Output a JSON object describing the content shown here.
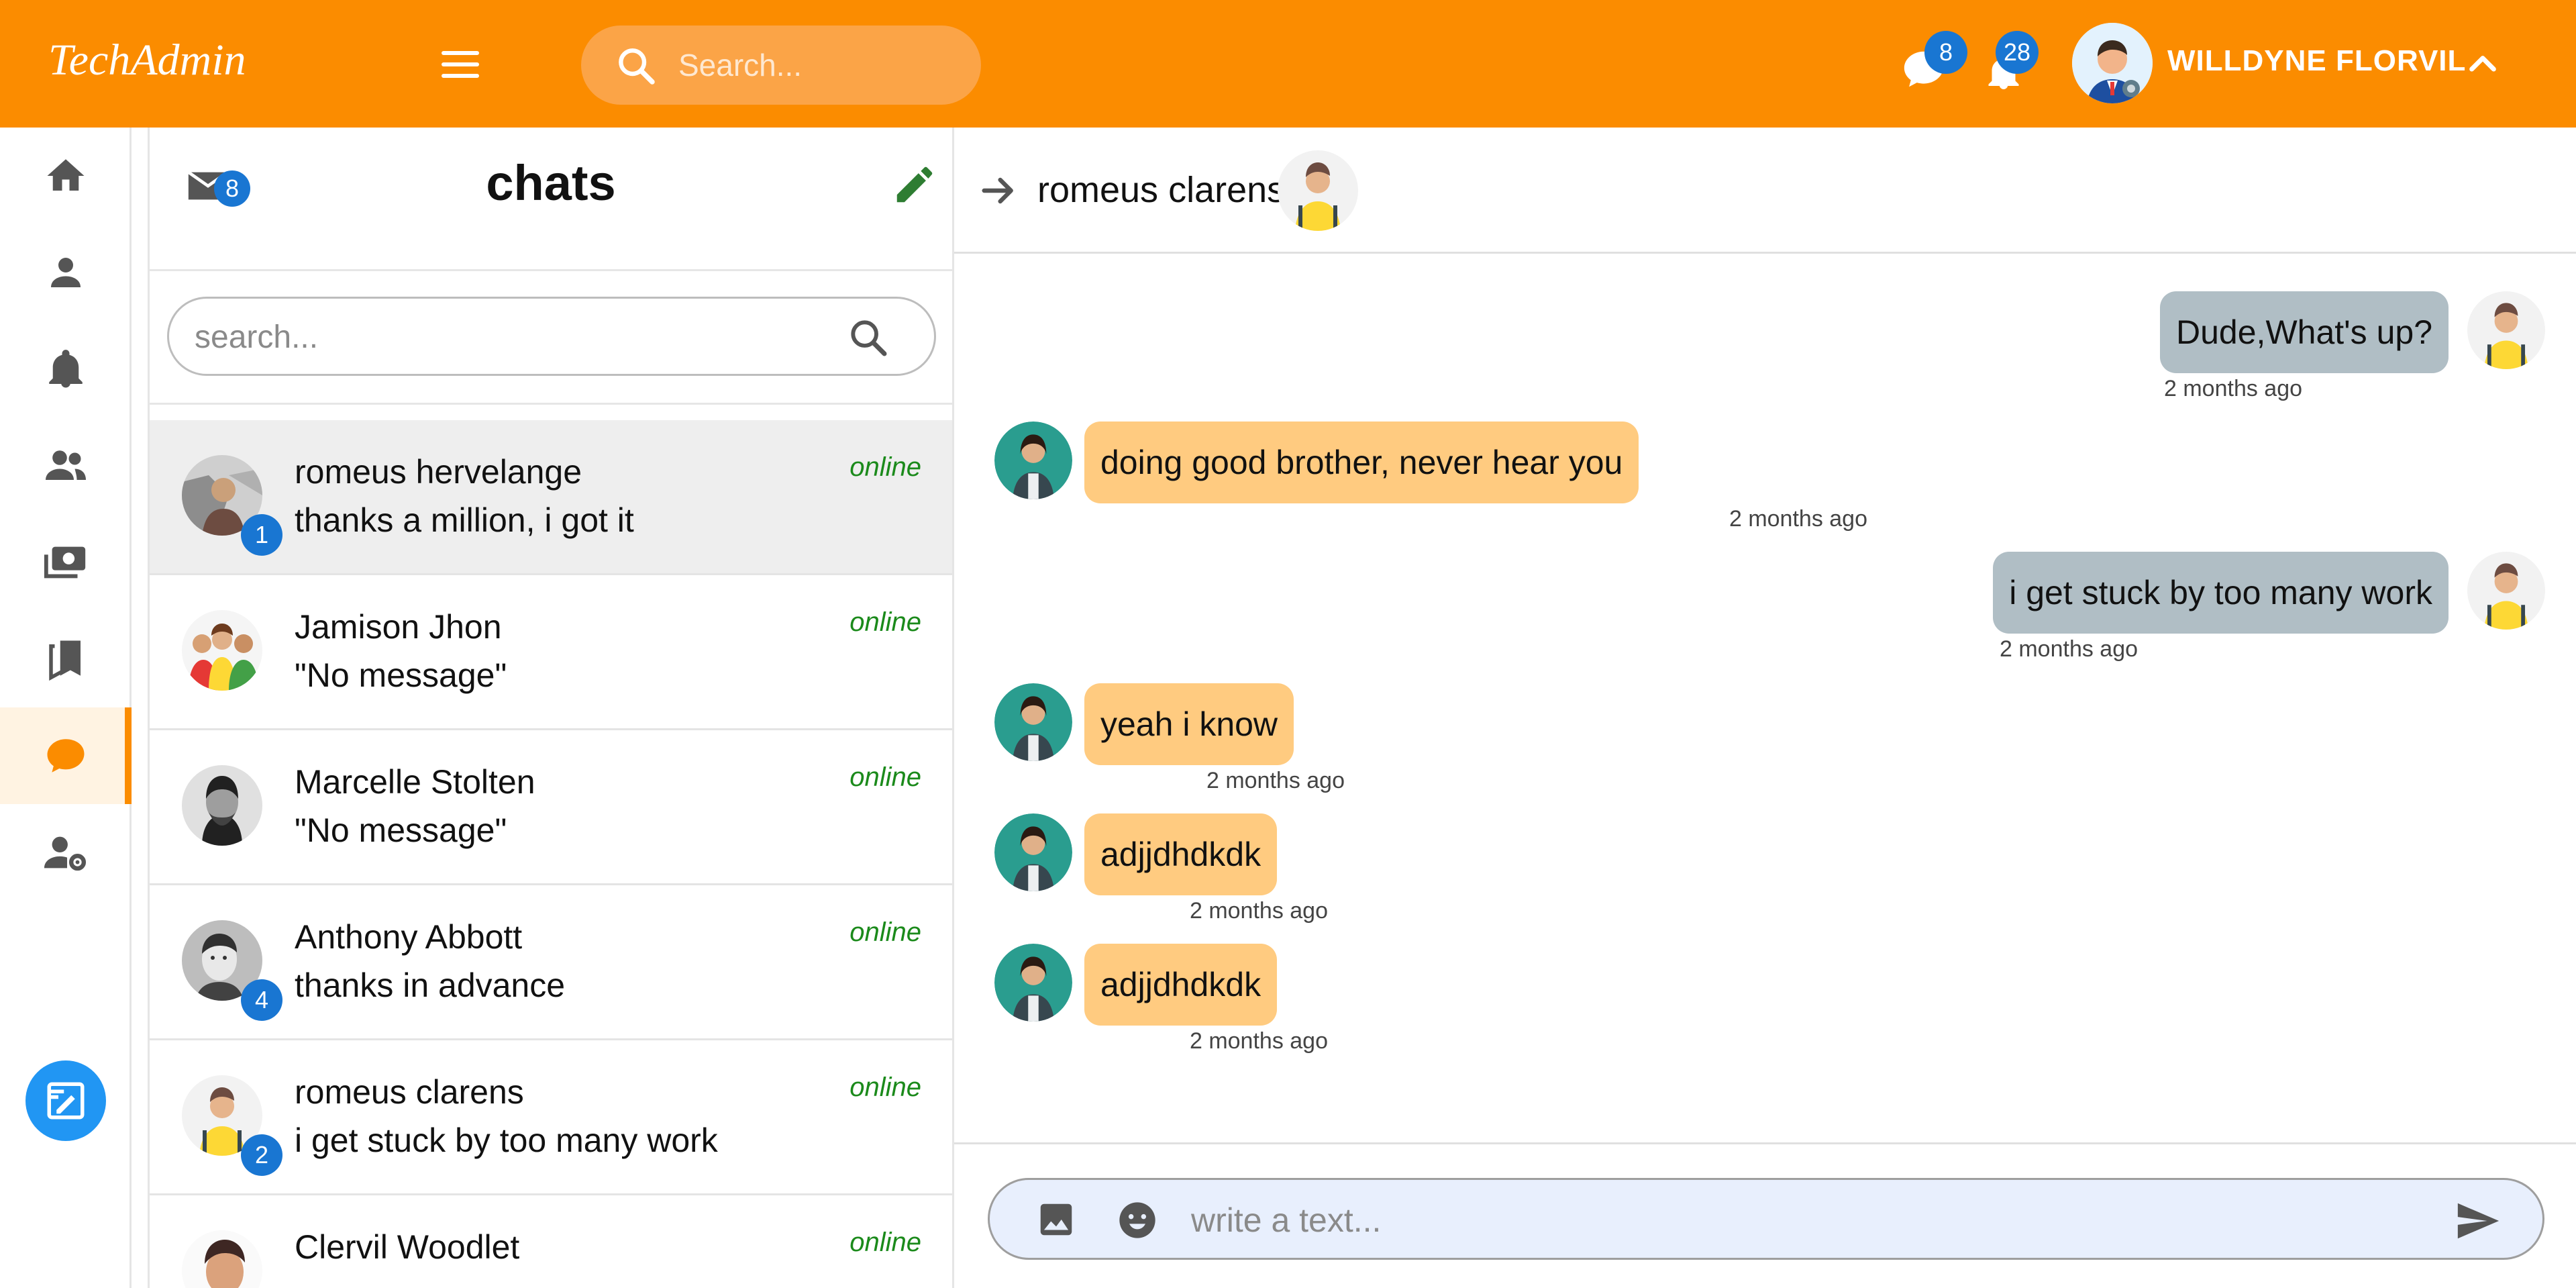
{
  "colors": {
    "brand": "#fb8c00",
    "badge": "#1976d2",
    "online": "#1b8a1b",
    "incoming_bubble": "#ffcb80",
    "outgoing_bubble": "#b0bec5",
    "composer_bg": "#e8effd"
  },
  "topbar": {
    "brand": "TechAdmin",
    "search_placeholder": "Search...",
    "messages_count": "8",
    "notifications_count": "28",
    "user_name": "WILLDYNE FLORVIL"
  },
  "nav": {
    "items": [
      "home-icon",
      "person-icon",
      "bell-icon",
      "group-icon",
      "money-icon",
      "bookmarks-icon",
      "chat-icon",
      "manage-accounts-icon"
    ],
    "active": "chat-icon"
  },
  "chatlist": {
    "title": "chats",
    "unread_total": "8",
    "search_placeholder": "search...",
    "rows": [
      {
        "name": "romeus hervelange",
        "message": "thanks a million, i got it",
        "status": "online",
        "badge": "1"
      },
      {
        "name": "Jamison Jhon",
        "message": "\"No message\"",
        "status": "online",
        "badge": ""
      },
      {
        "name": "Marcelle Stolten",
        "message": "\"No message\"",
        "status": "online",
        "badge": ""
      },
      {
        "name": "Anthony Abbott",
        "message": "thanks in advance",
        "status": "online",
        "badge": "4"
      },
      {
        "name": "romeus clarens",
        "message": "i get stuck by too many work",
        "status": "online",
        "badge": "2"
      },
      {
        "name": "Clervil Woodlet",
        "message": "",
        "status": "online",
        "badge": ""
      }
    ]
  },
  "conversation": {
    "contact": "romeus clarens",
    "messages": [
      {
        "dir": "out",
        "text": "Dude,What's up?",
        "time": "2 months ago"
      },
      {
        "dir": "in",
        "text": "doing good brother, never hear you",
        "time": "2 months ago"
      },
      {
        "dir": "out",
        "text": "i get stuck by too many work",
        "time": "2 months ago"
      },
      {
        "dir": "in",
        "text": "yeah i know",
        "time": "2 months ago"
      },
      {
        "dir": "in",
        "text": "adjjdhdkdk",
        "time": "2 months ago"
      },
      {
        "dir": "in",
        "text": "adjjdhdkdk",
        "time": "2 months ago"
      }
    ],
    "composer_placeholder": "write a text..."
  }
}
